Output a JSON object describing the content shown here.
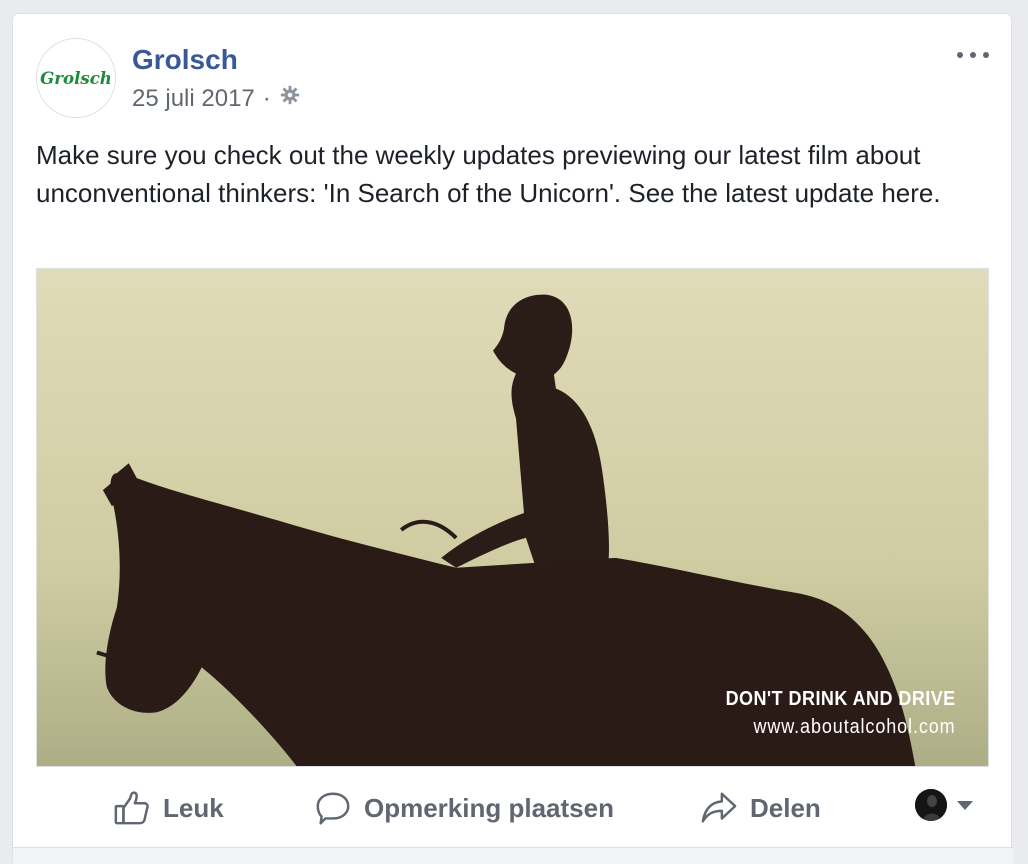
{
  "post": {
    "page_name": "Grolsch",
    "logo_text": "Grolsch",
    "date": "25 juli 2017",
    "separator": "·",
    "privacy_icon": "gear-icon",
    "more_icon": "ellipsis-icon",
    "text": "Make sure you check out the weekly updates previewing our latest film about unconventional thinkers: 'In Search of the Unicorn'. See the latest update here.",
    "media": {
      "overlay_title": "DON'T DRINK AND DRIVE",
      "overlay_url": "www.aboutalcohol.com"
    }
  },
  "actions": {
    "like": {
      "label": "Leuk",
      "icon": "thumbs-up-icon"
    },
    "comment": {
      "label": "Opmerking plaatsen",
      "icon": "comment-icon"
    },
    "share": {
      "label": "Delen",
      "icon": "share-icon"
    }
  },
  "colors": {
    "link": "#385898",
    "text": "#1d2129",
    "muted": "#606770",
    "logo_green": "#1e8a3a"
  }
}
